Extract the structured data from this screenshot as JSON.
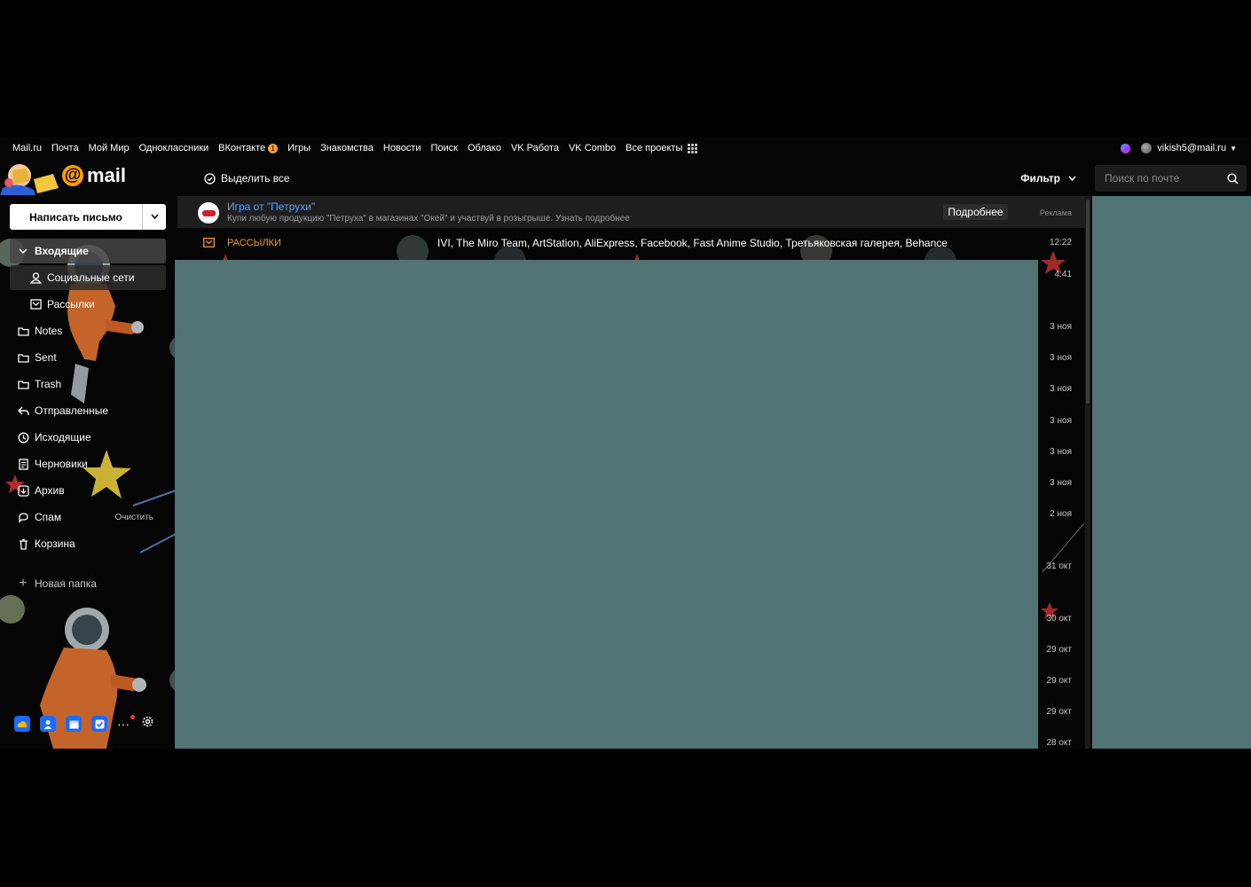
{
  "portal": {
    "links": [
      "Mail.ru",
      "Почта",
      "Мой Мир",
      "Одноклассники",
      "ВКонтакте",
      "Игры",
      "Знакомства",
      "Новости",
      "Поиск",
      "Облако",
      "VK Работа",
      "VK Combo",
      "Все проекты"
    ],
    "vk_badge": "1",
    "user_email": "vikish5@mail.ru"
  },
  "logo": {
    "text": "mail"
  },
  "compose": {
    "label": "Написать письмо"
  },
  "folders": {
    "inbox": "Входящие",
    "social": "Социальные сети",
    "newsletters": "Рассылки",
    "notes": "Notes",
    "sent_en": "Sent",
    "trash_en": "Trash",
    "sent": "Отправленные",
    "outbox": "Исходящие",
    "drafts": "Черновики",
    "archive": "Архив",
    "spam": "Спам",
    "spam_clear": "Очистить",
    "bin": "Корзина",
    "new_folder": "Новая папка"
  },
  "toolbar": {
    "select_all": "Выделить все",
    "filter": "Фильтр"
  },
  "search": {
    "placeholder": "Поиск по почте"
  },
  "ad": {
    "title": "Игра от \"Петрухи\"",
    "text": "Купи любую продукцию \"Петруха\" в магазинах \"Окей\" и участвуй в розыгрыше. Узнать подробнее",
    "button": "Подробнее",
    "label": "Реклама"
  },
  "newsletter_row": {
    "category": "РАССЫЛКИ",
    "senders": "IVI, The Miro Team, ArtStation, AliExpress, Facebook, Fast Anime Studio, Третьяковская галерея, Behance",
    "time": "12:22"
  },
  "times": [
    "4:41",
    "3 ноя",
    "3 ноя",
    "3 ноя",
    "3 ноя",
    "3 ноя",
    "3 ноя",
    "2 ноя",
    "31 окт",
    "30 окт",
    "29 окт",
    "29 окт",
    "29 окт",
    "28 окт"
  ],
  "colors": {
    "accent": "#ff9e00",
    "link": "#5aa0ff",
    "overlay": "#527373",
    "tool_blue": "#1a6cff"
  }
}
